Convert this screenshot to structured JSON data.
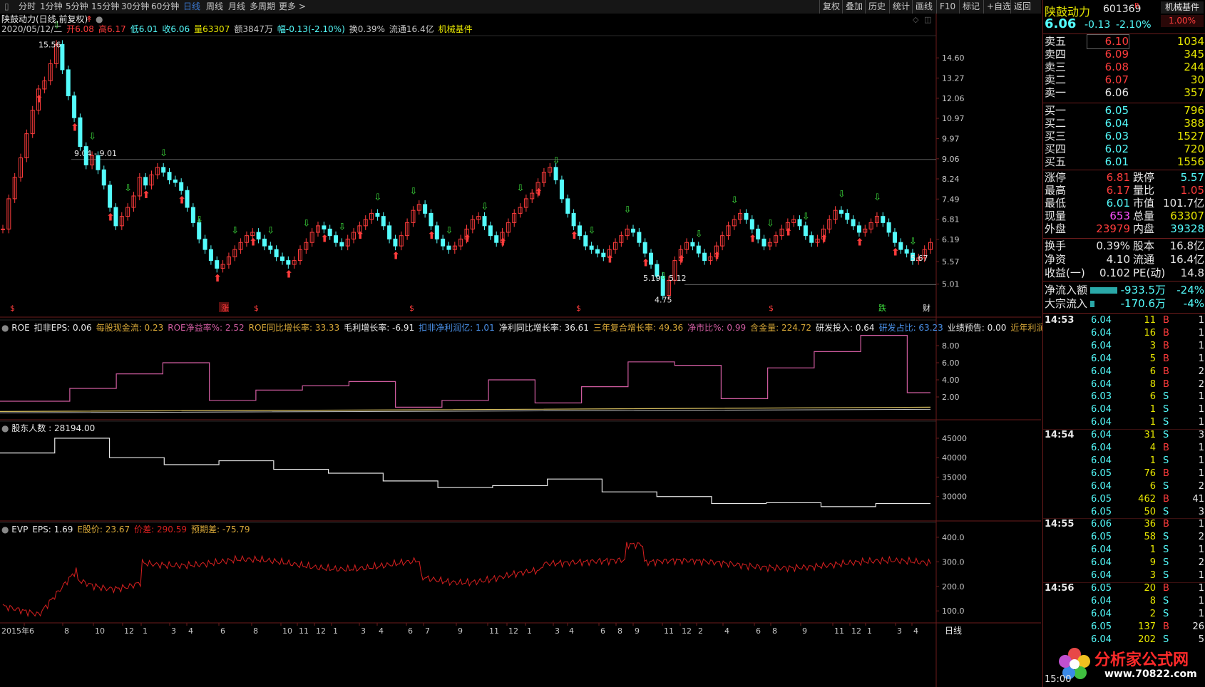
{
  "toolbar": {
    "periods": [
      "分时",
      "1分钟",
      "5分钟",
      "15分钟",
      "30分钟",
      "60分钟",
      "日线",
      "周线",
      "月线",
      "多周期",
      "更多 >"
    ],
    "active": "日线",
    "right_buttons": [
      "复权",
      "叠加",
      "历史",
      "统计",
      "画线",
      "F10",
      "标记",
      "+自选",
      "返回"
    ]
  },
  "main": {
    "title": "陕鼓动力(日线,前复权)",
    "info_line": {
      "date": "2020/05/12/二",
      "open": "开6.08",
      "high": "高6.17",
      "low": "低6.01",
      "close": "收6.06",
      "volume": "量63307",
      "amount": "额3847万",
      "change": "幅-0.13(-2.10%)",
      "turnover": "换0.39%",
      "float": "流通16.4亿",
      "sector": "机械基件"
    },
    "annotations": {
      "high": "15.56",
      "line": "9.04 - 9.01",
      "low": "4.75",
      "low2": "5.19",
      "low3": "5.12",
      "last": "5.67"
    },
    "signals": [
      "$",
      "涨",
      "$",
      "$",
      "$",
      "$",
      "跌",
      "财"
    ],
    "y_labels": [
      "14.60",
      "13.27",
      "12.06",
      "10.97",
      "9.97",
      "9.06",
      "8.24",
      "7.49",
      "6.81",
      "6.19",
      "5.57",
      "5.01"
    ],
    "price_series": [
      6.5,
      7.5,
      8.3,
      9.1,
      10.2,
      11.4,
      12.6,
      13.1,
      14.2,
      15.56,
      13.8,
      12.2,
      11.0,
      9.6,
      8.8,
      9.2,
      8.6,
      8.0,
      7.2,
      6.6,
      6.9,
      7.2,
      7.6,
      8.3,
      8.0,
      8.4,
      8.7,
      8.5,
      8.2,
      8.1,
      7.8,
      7.2,
      6.7,
      6.2,
      5.9,
      5.6,
      5.4,
      5.5,
      5.7,
      5.9,
      6.1,
      6.3,
      6.4,
      6.2,
      6.0,
      5.9,
      5.7,
      5.6,
      5.5,
      5.6,
      5.9,
      6.1,
      6.4,
      6.6,
      6.5,
      6.3,
      6.1,
      6.0,
      6.2,
      6.4,
      6.6,
      6.8,
      7.0,
      6.9,
      6.6,
      6.2,
      6.0,
      6.3,
      6.7,
      7.1,
      7.3,
      7.0,
      6.6,
      6.2,
      6.0,
      5.9,
      6.0,
      6.2,
      6.5,
      6.8,
      6.9,
      6.6,
      6.3,
      6.1,
      6.4,
      6.7,
      7.0,
      7.2,
      7.5,
      7.7,
      8.1,
      8.5,
      8.7,
      8.2,
      7.5,
      7.0,
      6.6,
      6.3,
      6.0,
      5.9,
      5.8,
      5.7,
      5.9,
      6.1,
      6.3,
      6.5,
      6.4,
      6.1,
      5.8,
      5.5,
      5.2,
      4.75,
      5.1,
      5.6,
      5.9,
      6.1,
      6.0,
      5.8,
      5.6,
      5.7,
      6.0,
      6.3,
      6.6,
      6.8,
      7.0,
      6.8,
      6.5,
      6.2,
      6.0,
      6.1,
      6.3,
      6.5,
      6.7,
      6.8,
      6.6,
      6.3,
      6.1,
      6.2,
      6.5,
      6.8,
      7.1,
      7.0,
      6.8,
      6.6,
      6.4,
      6.5,
      6.7,
      6.9,
      6.7,
      6.4,
      6.1,
      5.9,
      5.8,
      5.6,
      5.67,
      5.9,
      6.1
    ]
  },
  "roe": {
    "header": {
      "name": "ROE",
      "eps": "扣非EPS: 0.06",
      "cash": "每股现金流: 0.23",
      "roe": "ROE净益率%: 2.52",
      "roe_yoy": "ROE同比增长率: 33.33",
      "gross": "毛利增长率: -6.91",
      "kf": "扣非净利润亿: 1.01",
      "np": "净利同比增长率: 36.61",
      "cagr": "三年复合增长率: 49.36",
      "ratio": "净市比%: 0.99",
      "cash_ratio": "含金量: 224.72",
      "rd": "研发投入: 0.64",
      "rd_pct": "研发占比: 63.23",
      "forecast": "业绩预告: 0.00",
      "recent": "近年利润亿: "
    },
    "y_labels": [
      "8.00",
      "6.00",
      "4.00",
      "2.00"
    ],
    "steps": [
      1.5,
      1.5,
      1.5,
      3.0,
      3.0,
      4.7,
      4.7,
      6.0,
      6.0,
      1.6,
      1.6,
      2.8,
      2.8,
      3.3,
      3.3,
      3.8,
      3.8,
      0.8,
      0.8,
      1.6,
      1.6,
      4.0,
      4.0,
      1.3,
      1.3,
      3.2,
      3.2,
      6.1,
      6.1,
      5.7,
      5.7,
      1.8,
      1.8,
      5.4,
      5.4,
      7.3,
      7.3,
      9.2,
      9.2,
      2.5
    ]
  },
  "holders": {
    "header": "股东人数 : 28194.00",
    "y_labels": [
      "45000",
      "40000",
      "35000",
      "30000"
    ],
    "steps": [
      41200,
      41200,
      45000,
      45000,
      40000,
      40000,
      38200,
      38200,
      39200,
      39200,
      37000,
      37000,
      36000,
      36000,
      34000,
      34000,
      32300,
      32300,
      32800,
      32800,
      34500,
      34500,
      31200,
      31200,
      30000,
      30000,
      28200,
      28200,
      28400,
      28400,
      27400,
      27400,
      28194,
      28194
    ]
  },
  "evp": {
    "header": {
      "name": "EVP",
      "eps": "EPS: 1.69",
      "price": "E股价: 23.67",
      "diff": "价差: 290.59",
      "expect": "预期差: -75.79"
    },
    "y_labels": [
      "400.0",
      "300.0",
      "200.0",
      "100.0"
    ]
  },
  "x_labels": [
    "2015年6",
    "8",
    "10",
    "12",
    "1",
    "3",
    "4",
    "6",
    "8",
    "10",
    "11",
    "12",
    "1",
    "3",
    "4",
    "6",
    "7",
    "9",
    "11",
    "12",
    "1",
    "3",
    "4",
    "6",
    "8",
    "9",
    "11",
    "12",
    "2",
    "4",
    "6",
    "8",
    "9",
    "11",
    "12",
    "1",
    "3",
    "4"
  ],
  "x_right": "日线",
  "panel": {
    "name": "陕鼓动力",
    "code": "601369",
    "code_flag": "R",
    "sector": "机械基件",
    "sector_pct": "1.00%",
    "price": "6.06",
    "change": "-0.13",
    "pct": "-2.10%",
    "asks": [
      {
        "label": "卖五",
        "price": "6.10",
        "vol": "1034"
      },
      {
        "label": "卖四",
        "price": "6.09",
        "vol": "345"
      },
      {
        "label": "卖三",
        "price": "6.08",
        "vol": "244"
      },
      {
        "label": "卖二",
        "price": "6.07",
        "vol": "30"
      },
      {
        "label": "卖一",
        "price": "6.06",
        "vol": "357"
      }
    ],
    "bids": [
      {
        "label": "买一",
        "price": "6.05",
        "vol": "796"
      },
      {
        "label": "买二",
        "price": "6.04",
        "vol": "388"
      },
      {
        "label": "买三",
        "price": "6.03",
        "vol": "1527"
      },
      {
        "label": "买四",
        "price": "6.02",
        "vol": "720"
      },
      {
        "label": "买五",
        "price": "6.01",
        "vol": "1556"
      }
    ],
    "stats": [
      {
        "l1": "涨停",
        "v1": "6.81",
        "l2": "跌停",
        "v2": "5.57"
      },
      {
        "l1": "最高",
        "v1": "6.17",
        "l2": "量比",
        "v2": "1.05"
      },
      {
        "l1": "最低",
        "v1": "6.01",
        "l2": "市值",
        "v2": "101.7亿"
      },
      {
        "l1": "现量",
        "v1": "653",
        "l2": "总量",
        "v2": "63307"
      },
      {
        "l1": "外盘",
        "v1": "23979",
        "l2": "内盘",
        "v2": "39328"
      }
    ],
    "stats2": [
      {
        "l1": "换手",
        "v1": "0.39%",
        "l2": "股本",
        "v2": "16.8亿"
      },
      {
        "l1": "净资",
        "v1": "4.10",
        "l2": "流通",
        "v2": "16.4亿"
      },
      {
        "l1": "收益(一)",
        "v1": "0.102",
        "l2": "PE(动)",
        "v2": "14.8"
      }
    ],
    "flows": [
      {
        "label": "净流入额",
        "value": "-933.5万",
        "pct": "-24%",
        "frac": 0.24
      },
      {
        "label": "大宗流入",
        "value": "-170.6万",
        "pct": "-4%",
        "frac": 0.04
      }
    ],
    "ticks": [
      {
        "time": "14:53",
        "rows": [
          [
            "6.04",
            "11",
            "B",
            "1"
          ],
          [
            "6.04",
            "16",
            "B",
            "1"
          ],
          [
            "6.04",
            "3",
            "B",
            "1"
          ],
          [
            "6.04",
            "5",
            "B",
            "1"
          ],
          [
            "6.04",
            "6",
            "B",
            "2"
          ],
          [
            "6.04",
            "8",
            "B",
            "2"
          ],
          [
            "6.03",
            "6",
            "S",
            "1"
          ],
          [
            "6.04",
            "1",
            "S",
            "1"
          ],
          [
            "6.04",
            "1",
            "S",
            "1"
          ]
        ]
      },
      {
        "time": "14:54",
        "rows": [
          [
            "6.04",
            "31",
            "S",
            "3"
          ],
          [
            "6.04",
            "4",
            "B",
            "1"
          ],
          [
            "6.04",
            "1",
            "S",
            "1"
          ],
          [
            "6.05",
            "76",
            "B",
            "1"
          ],
          [
            "6.04",
            "6",
            "S",
            "2"
          ],
          [
            "6.05",
            "462",
            "B",
            "41"
          ],
          [
            "6.05",
            "50",
            "S",
            "3"
          ]
        ]
      },
      {
        "time": "14:55",
        "rows": [
          [
            "6.06",
            "36",
            "B",
            "1"
          ],
          [
            "6.05",
            "58",
            "S",
            "2"
          ],
          [
            "6.04",
            "1",
            "S",
            "1"
          ],
          [
            "6.04",
            "9",
            "S",
            "2"
          ],
          [
            "6.04",
            "3",
            "S",
            "1"
          ]
        ]
      },
      {
        "time": "14:56",
        "rows": [
          [
            "6.05",
            "20",
            "B",
            "1"
          ],
          [
            "6.04",
            "8",
            "S",
            "1"
          ],
          [
            "6.04",
            "2",
            "S",
            "1"
          ],
          [
            "6.05",
            "137",
            "B",
            "26"
          ],
          [
            "6.04",
            "202",
            "S",
            "5"
          ]
        ]
      }
    ],
    "watermark": {
      "cn": "分析家公式网",
      "url": "www.70822.com"
    },
    "bottom_time": "15:00"
  },
  "colors": {
    "up": "#ff3c3c",
    "down": "#54fcfc",
    "green": "#3cdc3c",
    "yellow": "#e8e800",
    "magenta": "#ff50ff",
    "orange": "#e8a000",
    "blue": "#4a90e8",
    "roeLine": "#d05ca0",
    "evpLine": "#d82020"
  }
}
